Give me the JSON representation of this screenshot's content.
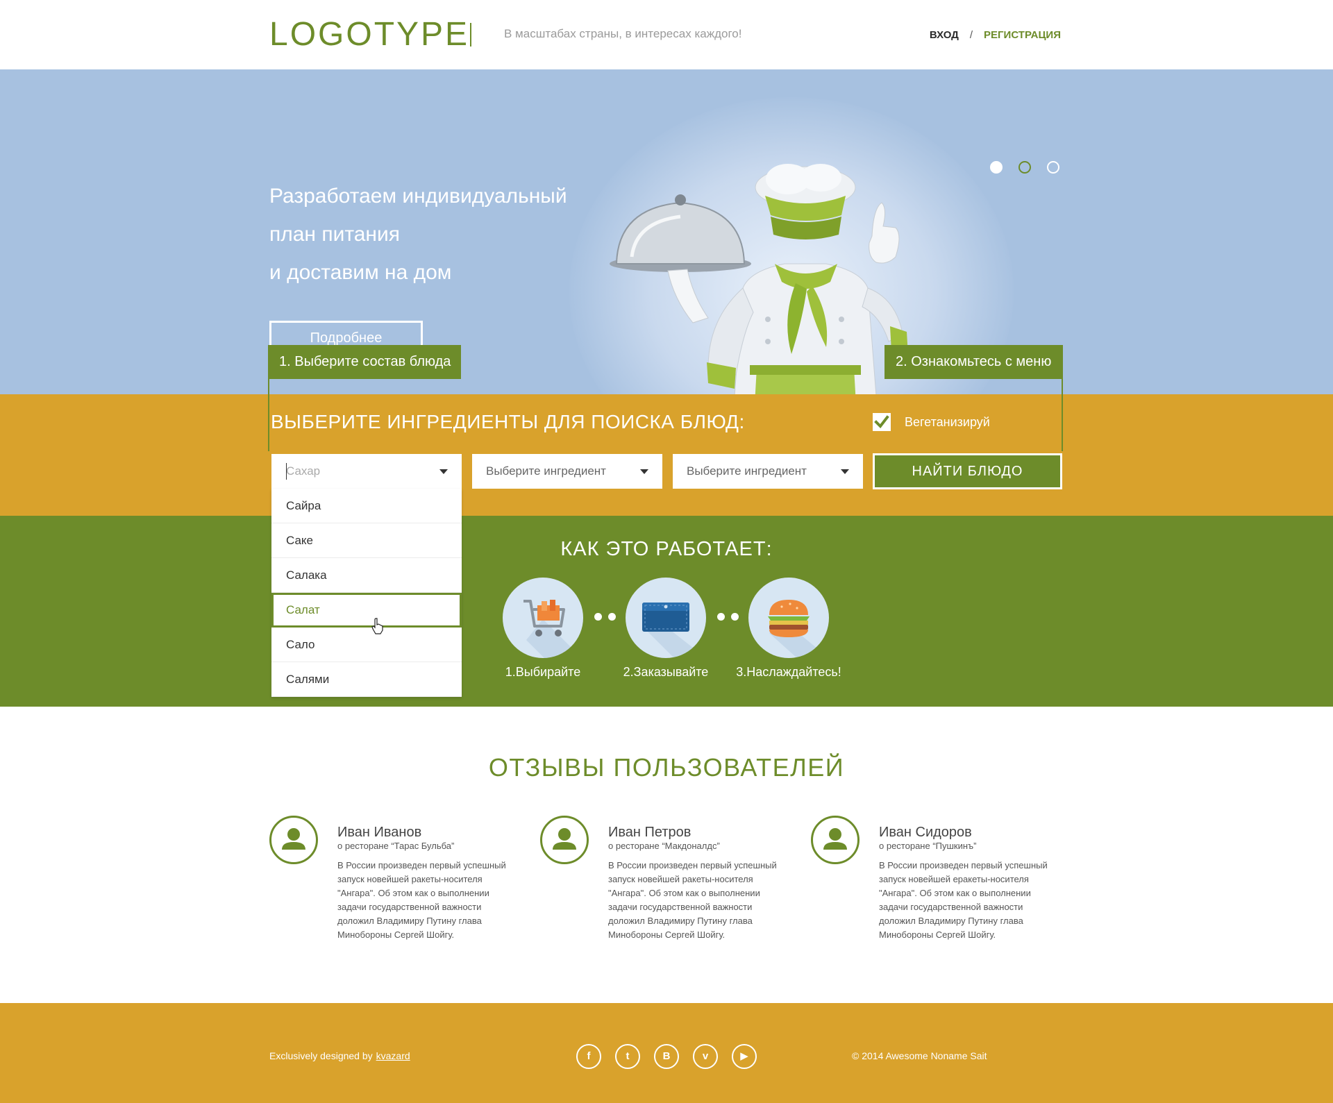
{
  "header": {
    "logo": "LOGOTYPE",
    "slogan": "В масштабах страны, в интересах каждого!",
    "login": "ВХОД",
    "separator": "/",
    "register": "РЕГИСТРАЦИЯ"
  },
  "hero": {
    "title_lines": [
      "Разработаем индивидуальный",
      "план питания",
      "и доставим на дом"
    ],
    "more_button": "Подробнее",
    "slides": {
      "count": 3,
      "active_index": 1
    }
  },
  "steps_tabs": {
    "step1": "1. Выберите состав блюда",
    "step2": "2. Ознакомьтесь с меню"
  },
  "search": {
    "title": "ВЫБЕРИТЕ ИНГРЕДИЕНТЫ ДЛЯ ПОИСКА БЛЮД:",
    "vegetarian_label": "Вегетанизируй",
    "vegetarian_checked": true,
    "select1_value": "Сахар",
    "select2_placeholder": "Выберите ингредиент",
    "select3_placeholder": "Выберите ингредиент",
    "find_button": "НАЙТИ БЛЮДО",
    "dropdown_items": [
      "Сайра",
      "Саке",
      "Салака",
      "Салат",
      "Сало",
      "Салями"
    ],
    "dropdown_active": "Салат"
  },
  "how_it_works": {
    "title": "КАК ЭТО РАБОТАЕТ:",
    "steps": [
      "1.Выбирайте",
      "2.Заказывайте",
      "3.Наслаждайтесь!"
    ],
    "icons": [
      "shopping-cart-icon",
      "wallet-icon",
      "burger-icon"
    ]
  },
  "reviews": {
    "title": "ОТЗЫВЫ ПОЛЬЗОВАТЕЛЕЙ",
    "items": [
      {
        "name": "Иван Иванов",
        "restaurant": "о ресторане “Тарас Бульба”",
        "text": "В России произведен первый успешный запуск новейшей ракеты-носителя \"Ангара\". Об этом как о выполнении задачи государственной важности доложил Владимиру Путину глава Минобороны Сергей Шойгу."
      },
      {
        "name": "Иван Петров",
        "restaurant": "о ресторане “Макдоналдс”",
        "text": "В России произведен первый успешный запуск новейшей ракеты-носителя \"Ангара\". Об этом как о выполнении задачи государственной важности доложил Владимиру Путину глава Минобороны Сергей Шойгу."
      },
      {
        "name": "Иван Сидоров",
        "restaurant": "о ресторане “Пушкинъ”",
        "text": "В России произведен первый успешный запуск новейшей еракеты-носителя \"Ангара\". Об этом как о выполнении задачи государственной важности доложил Владимиру Путину глава Минобороны Сергей Шойгу."
      }
    ]
  },
  "footer": {
    "designed_by": "Exclusively designed by",
    "designer": "kvazard",
    "socials": [
      {
        "name": "facebook-icon",
        "glyph": "f"
      },
      {
        "name": "twitter-icon",
        "glyph": "t"
      },
      {
        "name": "vk-icon",
        "glyph": "B"
      },
      {
        "name": "vimeo-icon",
        "glyph": "v"
      },
      {
        "name": "youtube-icon",
        "glyph": "▶"
      }
    ],
    "copyright": "© 2014 Awesome Noname Sait"
  },
  "colors": {
    "green": "#6d8c2a",
    "mustard": "#d9a22c",
    "sky": "#a7c1e0",
    "white": "#ffffff"
  }
}
